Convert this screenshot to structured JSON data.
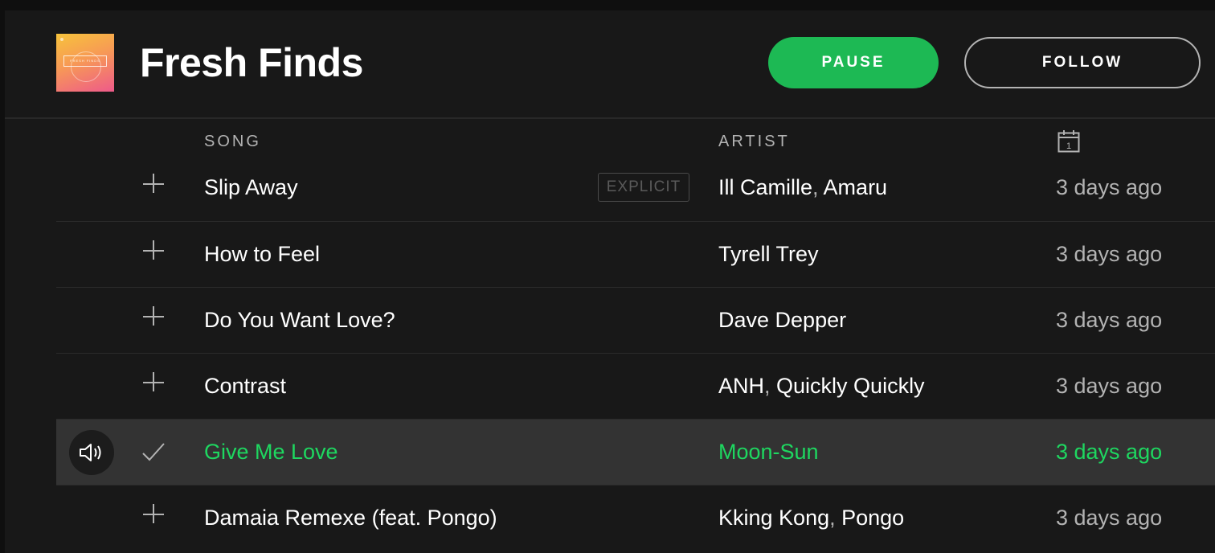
{
  "playlist": {
    "title": "Fresh Finds",
    "cover_text": "FRESH FINDS"
  },
  "actions": {
    "pause_label": "PAUSE",
    "follow_label": "FOLLOW"
  },
  "columns": {
    "song": "SONG",
    "artist": "ARTIST",
    "added_icon": "calendar-icon",
    "added_icon_text": "1"
  },
  "colors": {
    "accent": "#1db954",
    "playing_text": "#1ed760",
    "background": "#181818"
  },
  "tracks": [
    {
      "song": "Slip Away",
      "explicit": "EXPLICIT",
      "artists": [
        "Ill Camille",
        "Amaru"
      ],
      "added": "3 days ago",
      "saved": false,
      "playing": false
    },
    {
      "song": "How to Feel",
      "artists": [
        "Tyrell Trey"
      ],
      "added": "3 days ago",
      "saved": false,
      "playing": false
    },
    {
      "song": "Do You Want Love?",
      "artists": [
        "Dave Depper"
      ],
      "added": "3 days ago",
      "saved": false,
      "playing": false
    },
    {
      "song": "Contrast",
      "artists": [
        "ANH",
        "Quickly Quickly"
      ],
      "added": "3 days ago",
      "saved": false,
      "playing": false
    },
    {
      "song": "Give Me Love",
      "artists": [
        "Moon-Sun"
      ],
      "added": "3 days ago",
      "saved": true,
      "playing": true
    },
    {
      "song": "Damaia Remexe (feat. Pongo)",
      "artists": [
        "Kking Kong",
        "Pongo"
      ],
      "added": "3 days ago",
      "saved": false,
      "playing": false
    }
  ]
}
